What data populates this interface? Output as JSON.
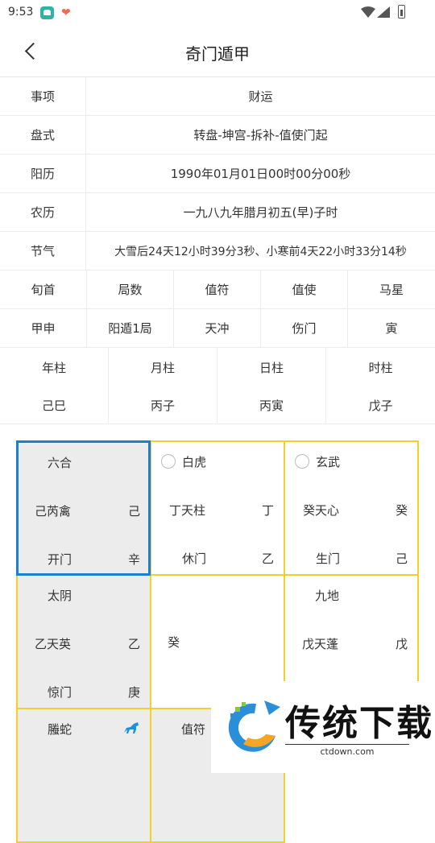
{
  "status": {
    "time": "9:53"
  },
  "header": {
    "title": "奇门遁甲"
  },
  "info": [
    {
      "key": "事项",
      "value": "财运"
    },
    {
      "key": "盘式",
      "value": "转盘-坤宫-拆补-值使门起"
    },
    {
      "key": "阳历",
      "value": "1990年01月01日00时00分00秒"
    },
    {
      "key": "农历",
      "value": "一九八九年腊月初五(早)子时"
    },
    {
      "key": "节气",
      "value": "大雪后24天12小时39分3秒、小寒前4天22小时33分14秒"
    }
  ],
  "five_header": [
    "旬首",
    "局数",
    "值符",
    "值使",
    "马星"
  ],
  "five_values": [
    "甲申",
    "阳遁1局",
    "天冲",
    "伤门",
    "寅"
  ],
  "pillars": [
    {
      "label": "年柱",
      "value": "己巳"
    },
    {
      "label": "月柱",
      "value": "丙子"
    },
    {
      "label": "日柱",
      "value": "丙寅"
    },
    {
      "label": "时柱",
      "value": "戊子"
    }
  ],
  "palaces": [
    {
      "god": "六合",
      "star": "己芮禽",
      "star_stem": "己",
      "door": "开门",
      "door_stem": "辛"
    },
    {
      "god": "白虎",
      "star": "丁天柱",
      "star_stem": "丁",
      "door": "休门",
      "door_stem": "乙"
    },
    {
      "god": "玄武",
      "star": "癸天心",
      "star_stem": "癸",
      "door": "生门",
      "door_stem": "己"
    },
    {
      "god": "太阴",
      "star": "乙天英",
      "star_stem": "乙",
      "door": "惊门",
      "door_stem": "庚"
    },
    {
      "center": "癸"
    },
    {
      "god": "九地",
      "star": "戊天蓬",
      "star_stem": "戊"
    },
    {
      "god": "螣蛇"
    },
    {
      "god": "值符"
    }
  ],
  "watermark": {
    "text": "传统下载",
    "url": "ctdown.com"
  },
  "colors": {
    "selected_border": "#1b7fd0",
    "grid_border": "#f2cf2a",
    "shaded_bg": "#ececec",
    "horse": "#1b8fe0"
  },
  "icons": [
    "back-arrow-icon",
    "wifi-icon",
    "signal-icon",
    "battery-icon",
    "horse-icon"
  ]
}
